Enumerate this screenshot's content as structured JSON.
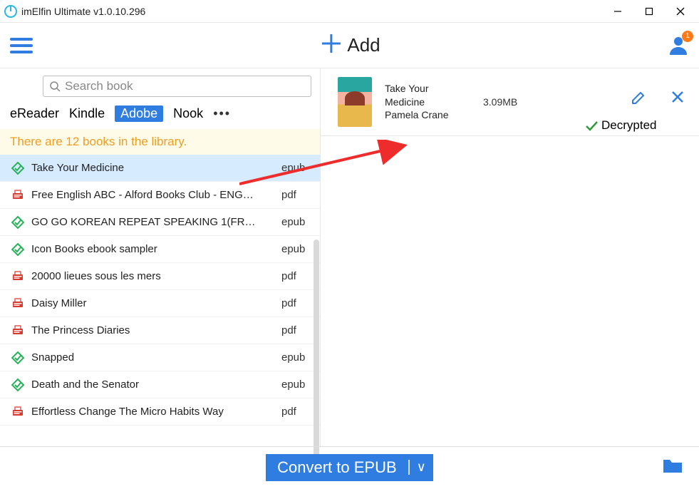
{
  "window": {
    "title": "imElfin Ultimate v1.0.10.296"
  },
  "toolbar": {
    "add_label": "Add",
    "badge_count": "1"
  },
  "search": {
    "placeholder": "Search book"
  },
  "tabs": {
    "items": [
      {
        "label": "eReader"
      },
      {
        "label": "Kindle"
      },
      {
        "label": "Adobe"
      },
      {
        "label": "Nook"
      }
    ],
    "active_index": 2
  },
  "notice": {
    "text": "There are 12 books in the library."
  },
  "books": [
    {
      "title": "Take Your Medicine",
      "format": "epub",
      "icon": "epub",
      "selected": true
    },
    {
      "title": "Free English ABC - Alford Books Club - ENG…",
      "format": "pdf",
      "icon": "pdf"
    },
    {
      "title": "GO GO KOREAN REPEAT SPEAKING 1(FR…",
      "format": "epub",
      "icon": "epub"
    },
    {
      "title": "Icon Books ebook sampler",
      "format": "epub",
      "icon": "epub"
    },
    {
      "title": "20000 lieues sous les mers",
      "format": "pdf",
      "icon": "pdf"
    },
    {
      "title": "Daisy Miller",
      "format": "pdf",
      "icon": "pdf"
    },
    {
      "title": "The Princess Diaries",
      "format": "pdf",
      "icon": "pdf"
    },
    {
      "title": "Snapped",
      "format": "epub",
      "icon": "epub"
    },
    {
      "title": "Death and the Senator",
      "format": "epub",
      "icon": "epub"
    },
    {
      "title": "Effortless Change The Micro Habits Way",
      "format": "pdf",
      "icon": "pdf"
    }
  ],
  "detail": {
    "title": "Take Your Medicine",
    "author": "Pamela Crane",
    "size": "3.09MB",
    "status": "Decrypted"
  },
  "bottom": {
    "convert_label": "Convert to EPUB"
  }
}
